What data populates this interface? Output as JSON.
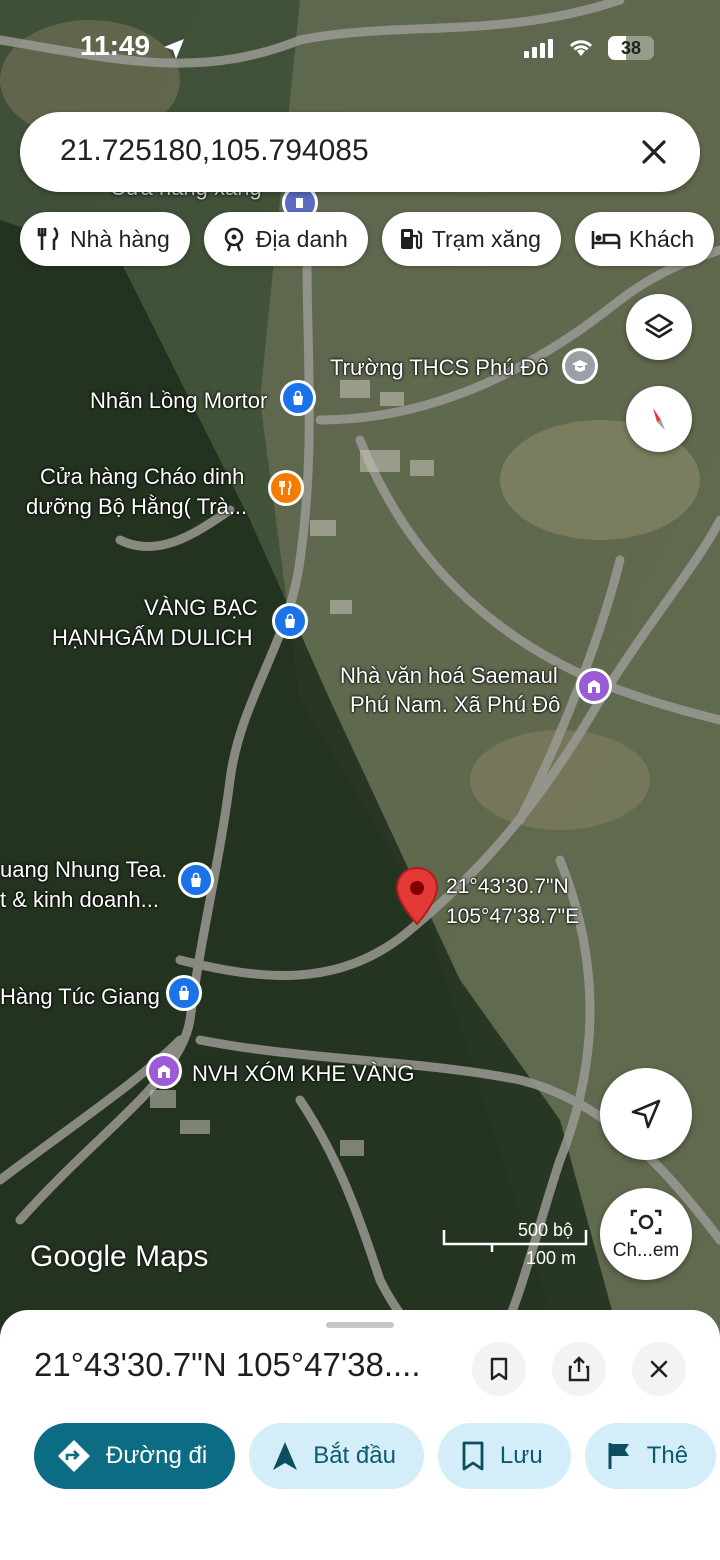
{
  "status_bar": {
    "time": "11:49",
    "battery": "38"
  },
  "search": {
    "query": "21.725180,105.794085"
  },
  "chips": [
    {
      "label": "Nhà hàng",
      "icon": "restaurant-icon"
    },
    {
      "label": "Địa danh",
      "icon": "landmark-icon"
    },
    {
      "label": "Trạm xăng",
      "icon": "gas-station-icon"
    },
    {
      "label": "Khách",
      "icon": "hotel-icon"
    }
  ],
  "map": {
    "places": {
      "top_partial": "Cửa hàng xăng",
      "truong": "Trường THCS Phú Đô",
      "nhanlong": "Nhãn Lồng Mortor",
      "chao_1": "Cửa hàng Cháo dinh",
      "chao_2": "dưỡng Bộ Hằng( Trà...",
      "vang_1": "VÀNG BẠC",
      "vang_2": "HẠNHGẤM DULICH",
      "nvh_1": "Nhà văn hoá Saemaul",
      "nvh_2": "Phú Nam. Xã Phú Đô",
      "tea_1": "uang Nhung Tea.",
      "tea_2": "t & kinh doanh...",
      "tuc": "Hàng Túc Giang",
      "khevang": "NVH XÓM KHE VÀNG"
    },
    "dropped_pin": {
      "lat": "21°43'30.7\"N",
      "lng": "105°47'38.7\"E"
    },
    "scale": {
      "imperial": "500 bộ",
      "metric": "100 m"
    },
    "brand": "Google Maps",
    "lens_button_label": "Ch...em"
  },
  "sheet": {
    "title": "21°43'30.7\"N 105°47'38....",
    "actions": [
      {
        "label": "Đường đi"
      },
      {
        "label": "Bắt đầu"
      },
      {
        "label": "Lưu"
      },
      {
        "label": "Thê"
      }
    ]
  },
  "colors": {
    "accent": "#0b6c83",
    "pin": "#e53935",
    "shop_pin": "#1a73e8",
    "food_pin": "#f57c00",
    "civic_pin": "#9c5bd6"
  }
}
